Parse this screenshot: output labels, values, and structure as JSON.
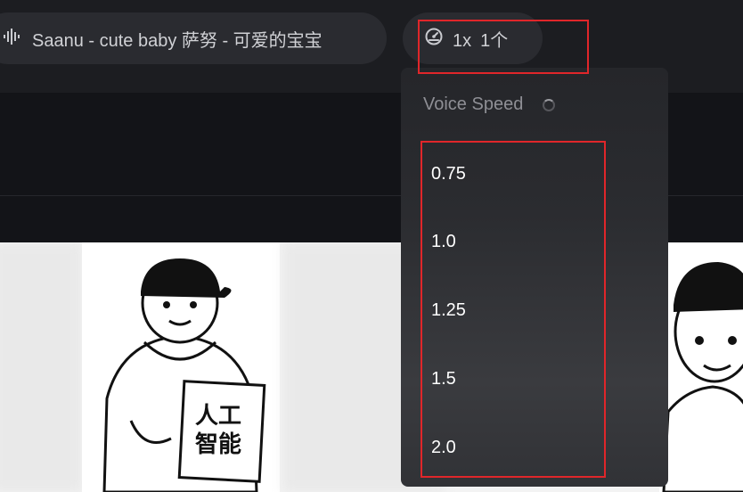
{
  "header": {
    "voice_label": "Saanu - cute baby  萨努 - 可爱的宝宝",
    "speed_value": "1x",
    "count_value": "1个"
  },
  "speed_menu": {
    "title": "Voice Speed",
    "options": [
      "0.75",
      "1.0",
      "1.25",
      "1.5",
      "2.0"
    ]
  },
  "gallery": {
    "sign_line1": "人工",
    "sign_line2": "智能"
  },
  "colors": {
    "highlight": "#e0262a",
    "panel": "#2a2b30",
    "background": "#141518"
  },
  "icons": [
    "audio-wave-icon",
    "speedometer-icon",
    "loading-spinner-icon"
  ]
}
